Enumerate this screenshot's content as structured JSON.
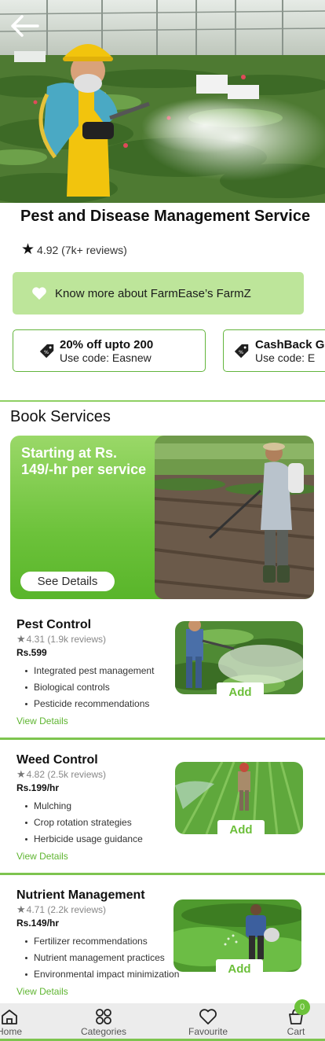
{
  "header": {
    "back_icon": "arrow-left-icon"
  },
  "service": {
    "title": "Pest and Disease Management Service",
    "rating": "4.92 (7k+ reviews)"
  },
  "banner": {
    "label": "Know more about FarmEase’s FarmZ",
    "icon": "heart-icon"
  },
  "coupons": [
    {
      "title": "20% off upto 200",
      "code": "Use code: Easnew"
    },
    {
      "title": "CashBack G",
      "code": "Use code: E"
    }
  ],
  "book_services": {
    "heading": "Book Services",
    "promo_text": "Starting at Rs. 149/-hr per service",
    "see_details": "See Details"
  },
  "services": [
    {
      "title": "Pest Control",
      "rating": "4.31 (1.9k reviews)",
      "price": "Rs.599",
      "features": [
        "Integrated pest management",
        "Biological controls",
        "Pesticide recommendations"
      ],
      "view": "View Details",
      "add": "Add"
    },
    {
      "title": "Weed Control",
      "rating": "4.82 (2.5k reviews)",
      "price": "Rs.199/hr",
      "features": [
        "Mulching",
        "Crop rotation strategies",
        "Herbicide usage guidance"
      ],
      "view": "View Details",
      "add": "Add"
    },
    {
      "title": "Nutrient Management",
      "rating": "4.71 (2.2k reviews)",
      "price": "Rs.149/hr",
      "features": [
        "Fertilizer recommendations",
        "Nutrient management practices",
        "Environmental impact minimization"
      ],
      "view": "View Details",
      "add": "Add"
    }
  ],
  "bottom_nav": {
    "items": [
      {
        "label": "Home",
        "icon": "home-icon"
      },
      {
        "label": "Categories",
        "icon": "categories-icon"
      },
      {
        "label": "Favourite",
        "icon": "heart-icon"
      },
      {
        "label": "Cart",
        "icon": "cart-icon"
      }
    ],
    "cart_count": "0"
  },
  "colors": {
    "accent": "#6cc23a",
    "banner_bg": "#bde59a",
    "divider": "#7ec44f"
  }
}
